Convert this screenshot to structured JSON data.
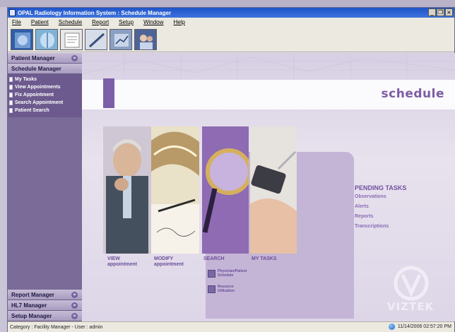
{
  "window": {
    "title": "OPAL Radiology Information System : Schedule Manager",
    "controls": {
      "minimize": "_",
      "restore": "❐",
      "close": "×"
    }
  },
  "menu": [
    "File",
    "Patient",
    "Schedule",
    "Report",
    "Setup",
    "Window",
    "Help"
  ],
  "toolbar": [
    {
      "name": "toolbar-scan-button",
      "icon": "xray-icon",
      "color": "#2f5ea8"
    },
    {
      "name": "toolbar-xray-button",
      "icon": "chest-xray-icon",
      "color": "#7fb3d6"
    },
    {
      "name": "toolbar-document-button",
      "icon": "document-icon",
      "color": "#e8e8e8"
    },
    {
      "name": "toolbar-pen-button",
      "icon": "pen-icon",
      "color": "#d6dce8"
    },
    {
      "name": "toolbar-chart-button",
      "icon": "chart-icon",
      "color": "#8aa0c4"
    },
    {
      "name": "toolbar-people-button",
      "icon": "people-icon",
      "color": "#4e6496"
    }
  ],
  "sidebar": {
    "patient_manager": {
      "label": "Patient Manager",
      "badge": "»"
    },
    "schedule_manager": {
      "label": "Schedule Manager"
    },
    "items": [
      "My Tasks",
      "View Appointments",
      "Fix Appointment",
      "Search Appointment",
      "Patient Search"
    ],
    "report_manager": {
      "label": "Report Manager",
      "badge": "»"
    },
    "hl7_manager": {
      "label": "HL7 Manager",
      "badge": "»"
    },
    "setup_manager": {
      "label": "Setup Manager",
      "badge": "»"
    }
  },
  "content": {
    "title": "schedule",
    "tiles": [
      {
        "line1": "VIEW",
        "line2": "appointment"
      },
      {
        "line1": "MODIFY",
        "line2": "appointment"
      },
      {
        "line1": "SEARCH",
        "line2": ""
      },
      {
        "line1": "MY TASKS",
        "line2": ""
      }
    ],
    "sublinks": [
      {
        "line1": "Physician/Patient",
        "line2": "Schedule"
      },
      {
        "line1": "Resource",
        "line2": "Utilization"
      }
    ],
    "pending": {
      "title": "PENDING TASKS",
      "items": [
        "Observations",
        "Alerts",
        "Reports",
        "Transcriptions"
      ]
    },
    "logo": "VIZTEK"
  },
  "status": {
    "left": "Category : Facility Manager   -   User : admin",
    "right": "11/14/2006 02:57:20 PM"
  },
  "colors": {
    "accent": "#7b5ca4",
    "sidebar": "#7a6b98",
    "titlebar": "#1e54c8"
  }
}
